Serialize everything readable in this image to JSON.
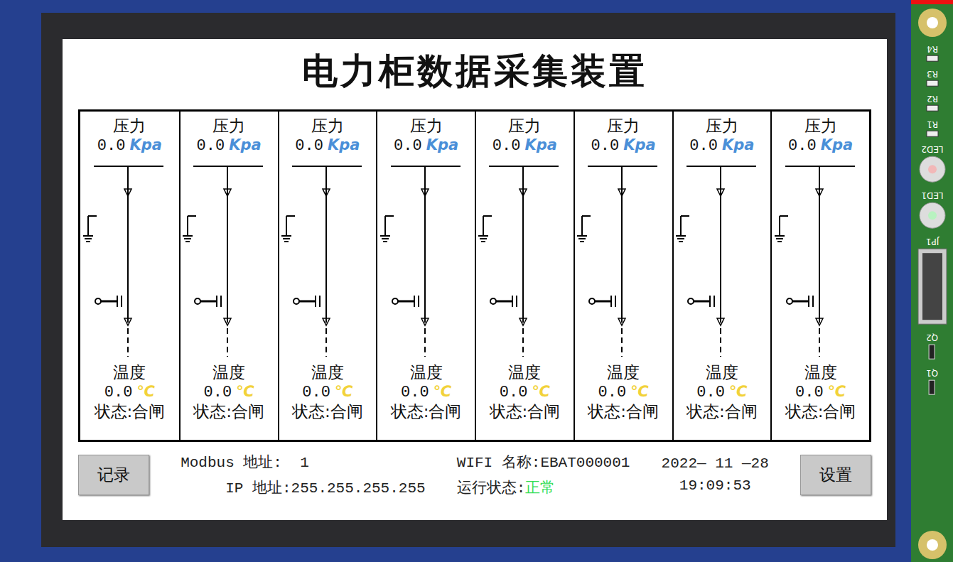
{
  "screen": {
    "title": "电力柜数据采集装置"
  },
  "cabinets": [
    {
      "pressure_label": "压力",
      "pressure": "0.0",
      "pressure_unit": "Kpa",
      "temp_label": "温度",
      "temp": "0.0",
      "temp_unit": "℃",
      "status": "状态:合闸"
    },
    {
      "pressure_label": "压力",
      "pressure": "0.0",
      "pressure_unit": "Kpa",
      "temp_label": "温度",
      "temp": "0.0",
      "temp_unit": "℃",
      "status": "状态:合闸"
    },
    {
      "pressure_label": "压力",
      "pressure": "0.0",
      "pressure_unit": "Kpa",
      "temp_label": "温度",
      "temp": "0.0",
      "temp_unit": "℃",
      "status": "状态:合闸"
    },
    {
      "pressure_label": "压力",
      "pressure": "0.0",
      "pressure_unit": "Kpa",
      "temp_label": "温度",
      "temp": "0.0",
      "temp_unit": "℃",
      "status": "状态:合闸"
    },
    {
      "pressure_label": "压力",
      "pressure": "0.0",
      "pressure_unit": "Kpa",
      "temp_label": "温度",
      "temp": "0.0",
      "temp_unit": "℃",
      "status": "状态:合闸"
    },
    {
      "pressure_label": "压力",
      "pressure": "0.0",
      "pressure_unit": "Kpa",
      "temp_label": "温度",
      "temp": "0.0",
      "temp_unit": "℃",
      "status": "状态:合闸"
    },
    {
      "pressure_label": "压力",
      "pressure": "0.0",
      "pressure_unit": "Kpa",
      "temp_label": "温度",
      "temp": "0.0",
      "temp_unit": "℃",
      "status": "状态:合闸"
    },
    {
      "pressure_label": "压力",
      "pressure": "0.0",
      "pressure_unit": "Kpa",
      "temp_label": "温度",
      "temp": "0.0",
      "temp_unit": "℃",
      "status": "状态:合闸"
    }
  ],
  "footer": {
    "record_button": "记录",
    "modbus_label": "Modbus 地址:",
    "modbus_value": "1",
    "ip_label": "IP 地址:",
    "ip_value": "255.255.255.255",
    "wifi_label": "WIFI 名称:",
    "wifi_value": "EBAT000001",
    "run_label": "运行状态:",
    "run_value": "正常",
    "date": "2022— 11 —28",
    "time": "19:09:53",
    "settings_button": "设置"
  },
  "board_labels": [
    {
      "text": "R4",
      "kind": "resistor"
    },
    {
      "text": "R3",
      "kind": "resistor"
    },
    {
      "text": "R2",
      "kind": "resistor"
    },
    {
      "text": "R1",
      "kind": "resistor"
    },
    {
      "text": "LED2",
      "kind": "led",
      "color": "#f2b8b8"
    },
    {
      "text": "LED1",
      "kind": "led",
      "color": "#b8f2c0"
    },
    {
      "text": "JP1",
      "kind": "connector"
    },
    {
      "text": "Q2",
      "kind": "transistor"
    },
    {
      "text": "Q1",
      "kind": "transistor"
    }
  ]
}
